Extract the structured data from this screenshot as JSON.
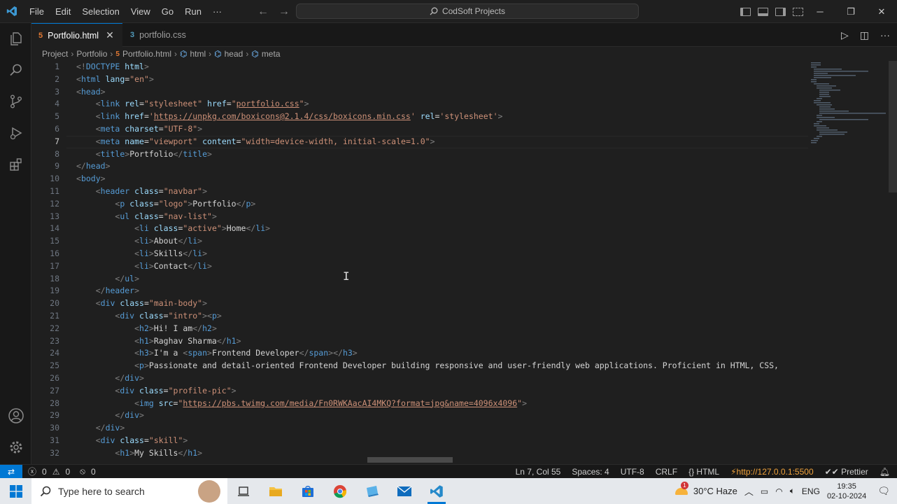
{
  "menu": [
    "File",
    "Edit",
    "Selection",
    "View",
    "Go",
    "Run",
    "···"
  ],
  "search_title": "CodSoft Projects",
  "tabs": [
    {
      "label": "Portfolio.html",
      "icon": "html-file-icon",
      "active": true
    },
    {
      "label": "portfolio.css",
      "icon": "css-file-icon",
      "active": false
    }
  ],
  "breadcrumb": [
    "Project",
    "Portfolio",
    "Portfolio.html",
    "html",
    "head",
    "meta"
  ],
  "code_lines": [
    "<!DOCTYPE html>",
    "<html lang=\"en\">",
    "<head>",
    "    <link rel=\"stylesheet\" href=\"portfolio.css\">",
    "    <link href='https://unpkg.com/boxicons@2.1.4/css/boxicons.min.css' rel='stylesheet'>",
    "    <meta charset=\"UTF-8\">",
    "    <meta name=\"viewport\" content=\"width=device-width, initial-scale=1.0\">",
    "    <title>Portfolio</title>",
    "</head>",
    "<body>",
    "    <header class=\"navbar\">",
    "        <p class=\"logo\">Portfolio</p>",
    "        <ul class=\"nav-list\">",
    "            <li class=\"active\">Home</li>",
    "            <li>About</li>",
    "            <li>Skills</li>",
    "            <li>Contact</li>",
    "        </ul>",
    "    </header>",
    "    <div class=\"main-body\">",
    "        <div class=\"intro\"><p>",
    "            <h2>Hi! I am</h2>",
    "            <h1>Raghav Sharma</h1>",
    "            <h3>I'm a <span>Frontend Developer</span></h3>",
    "            <p>Passionate and detail-oriented Frontend Developer building responsive and user-friendly web applications. Proficient in HTML, CSS,",
    "        </div>",
    "        <div class=\"profile-pic\">",
    "            <img src=\"https://pbs.twimg.com/media/Fn0RWKAacAI4MKQ?format=jpg&name=4096x4096\">",
    "        </div>",
    "    </div>",
    "    <div class=\"skill\">",
    "        <h1>My Skills</h1>"
  ],
  "current_line": 7,
  "status": {
    "errors": "0",
    "warnings": "0",
    "ports": "0",
    "cursor": "Ln 7, Col 55",
    "spaces": "Spaces: 4",
    "encoding": "UTF-8",
    "eol": "CRLF",
    "language": "HTML",
    "live_server": "http://127.0.0.1:5500",
    "formatter": "Prettier"
  },
  "taskbar": {
    "search_placeholder": "Type here to search",
    "weather": "30°C  Haze",
    "weather_badge": "1",
    "language": "ENG",
    "time": "19:35",
    "date": "02-10-2024"
  }
}
